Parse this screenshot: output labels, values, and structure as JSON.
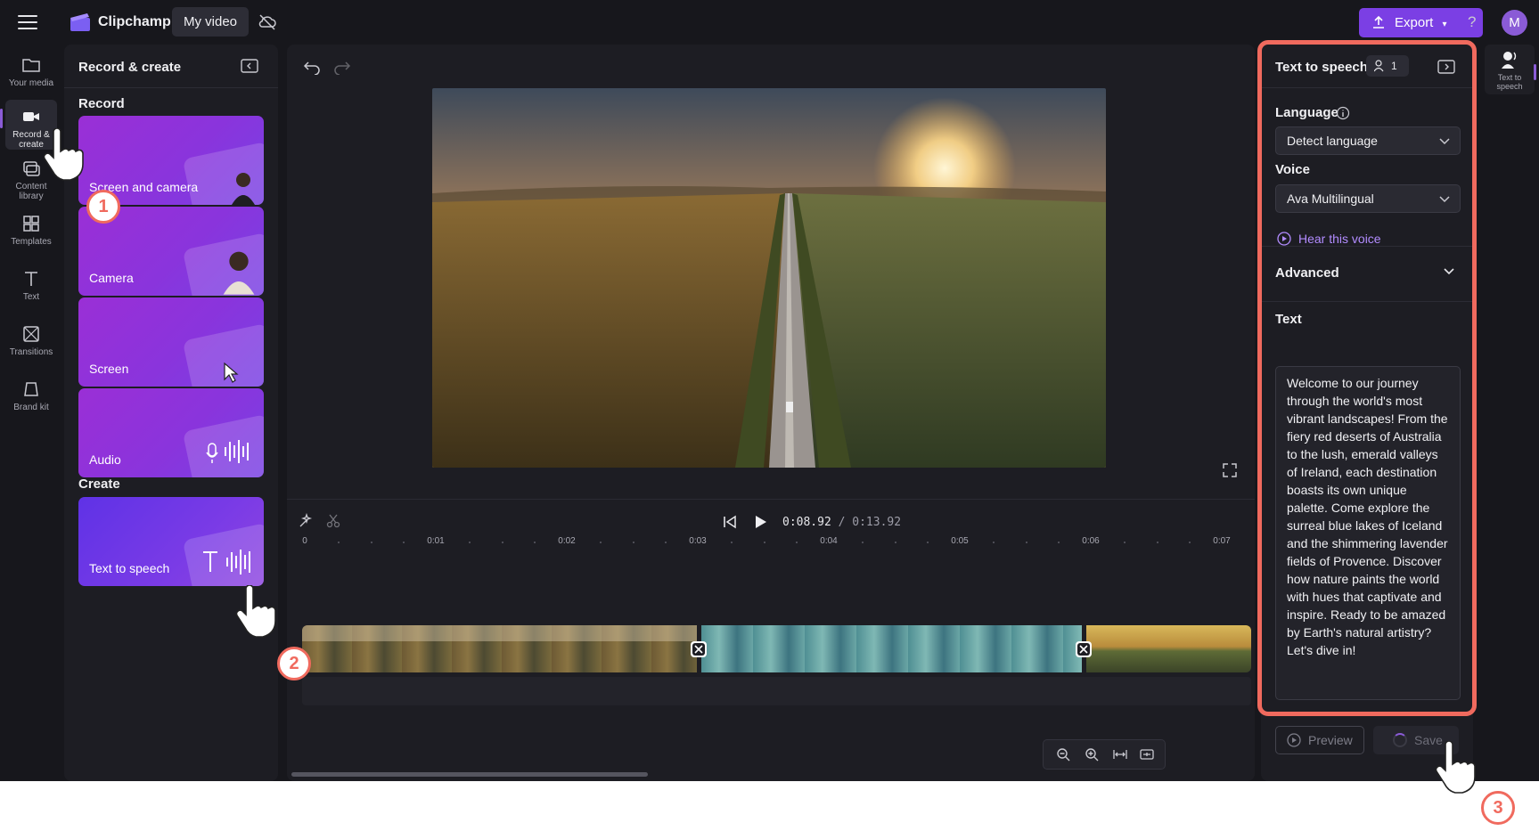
{
  "topbar": {
    "app_name": "Clipchamp",
    "video_tab": "My video",
    "export_label": "Export",
    "help_label": "?",
    "avatar_initial": "M"
  },
  "rail": {
    "items": [
      {
        "label": "Your media",
        "icon": "folder-icon"
      },
      {
        "label": "Record & create",
        "icon": "camera-icon"
      },
      {
        "label": "Content library",
        "icon": "content-library-icon"
      },
      {
        "label": "Templates",
        "icon": "templates-icon"
      },
      {
        "label": "Text",
        "icon": "text-icon"
      },
      {
        "label": "Transitions",
        "icon": "transitions-icon"
      },
      {
        "label": "Brand kit",
        "icon": "brand-kit-icon"
      }
    ]
  },
  "record_panel": {
    "title": "Record & create",
    "record_section": "Record",
    "create_section": "Create",
    "cards": [
      {
        "label": "Screen and camera"
      },
      {
        "label": "Camera"
      },
      {
        "label": "Screen"
      },
      {
        "label": "Audio"
      }
    ],
    "create_cards": [
      {
        "label": "Text to speech"
      }
    ]
  },
  "player": {
    "current_time": "0:08.92",
    "total_time": "/ 0:13.92"
  },
  "ruler": {
    "labels": [
      "0",
      "0:01",
      "0:02",
      "0:03",
      "0:04",
      "0:05",
      "0:06",
      "0:07"
    ]
  },
  "tts_panel": {
    "title": "Text to speech",
    "badge_count": "1",
    "language_label": "Language",
    "language_value": "Detect language",
    "voice_label": "Voice",
    "voice_value": "Ava Multilingual",
    "hear_voice": "Hear this voice",
    "advanced_label": "Advanced",
    "text_label": "Text",
    "text_value": "Welcome to our journey through the world's most vibrant landscapes! From the fiery red deserts of Australia to the lush, emerald valleys of Ireland, each destination boasts its own unique palette. Come explore the surreal blue lakes of Iceland and the shimmering lavender fields of Provence. Discover how nature paints the world with hues that captivate and inspire. Ready to be amazed by Earth's natural artistry? Let's dive in!",
    "preview_label": "Preview",
    "save_label": "Save"
  },
  "right_rail": {
    "item_label": "Text to speech",
    "icon": "text-to-speech-icon"
  },
  "steps": [
    "1",
    "2",
    "3"
  ],
  "colors": {
    "accent": "#7b3fe4",
    "highlight": "#f06a5e",
    "background": "#17171c",
    "panel": "#1d1d23"
  }
}
